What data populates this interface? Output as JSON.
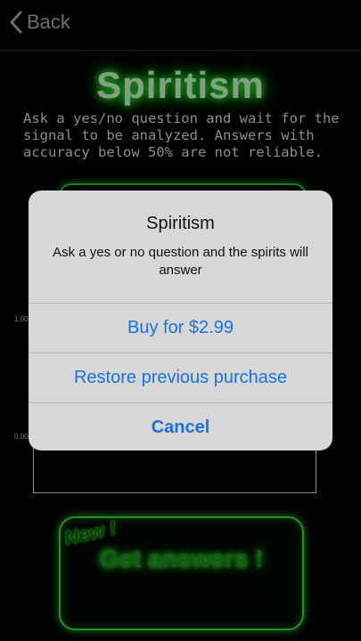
{
  "nav": {
    "back_label": "Back"
  },
  "screen": {
    "title": "Spiritism",
    "description": "Ask a yes/no question and wait for the signal to be analyzed. Answers with accuracy below 50% are not reliable.",
    "chart_ticks": [
      "1.00",
      "0.00"
    ],
    "new_badge": "New !",
    "get_answers_label": "Get answers !"
  },
  "alert": {
    "title": "Spiritism",
    "message": "Ask a yes or no question and the spirits will answer",
    "buy_label": "Buy for $2.99",
    "restore_label": "Restore previous purchase",
    "cancel_label": "Cancel"
  },
  "colors": {
    "accent_blue": "#1a73d9",
    "glow_green": "#3cff3c",
    "background": "#000000"
  }
}
